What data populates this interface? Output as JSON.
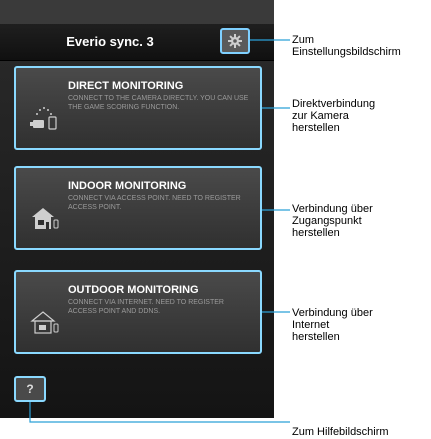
{
  "app": {
    "title": "Everio sync. 3"
  },
  "buttons": [
    {
      "title": "DIRECT MONITORING",
      "subtitle": "CONNECT TO THE CAMERA DIRECTLY. YOU CAN USE THE GAME SCORING FUNCTION."
    },
    {
      "title": "INDOOR MONITORING",
      "subtitle": "CONNECT VIA ACCESS POINT. NEED TO REGISTER ACCESS POINT."
    },
    {
      "title": "OUTDOOR MONITORING",
      "subtitle": "CONNECT VIA INTERNET. NEED TO REGISTER ACCESS POINT AND DDNS."
    }
  ],
  "help": {
    "label": "?"
  },
  "callouts": {
    "settings": [
      "Zum",
      "Einstellungsbildschirm"
    ],
    "direct": [
      "Direktverbindung",
      "zur Kamera",
      "herstellen"
    ],
    "indoor": [
      "Verbindung über",
      "Zugangspunkt",
      "herstellen"
    ],
    "outdoor": [
      "Verbindung über",
      "Internet",
      "herstellen"
    ],
    "help": [
      "Zum Hilfebildschirm"
    ]
  },
  "colors": {
    "highlight": "#8ad9ff",
    "panel": "#303030"
  }
}
